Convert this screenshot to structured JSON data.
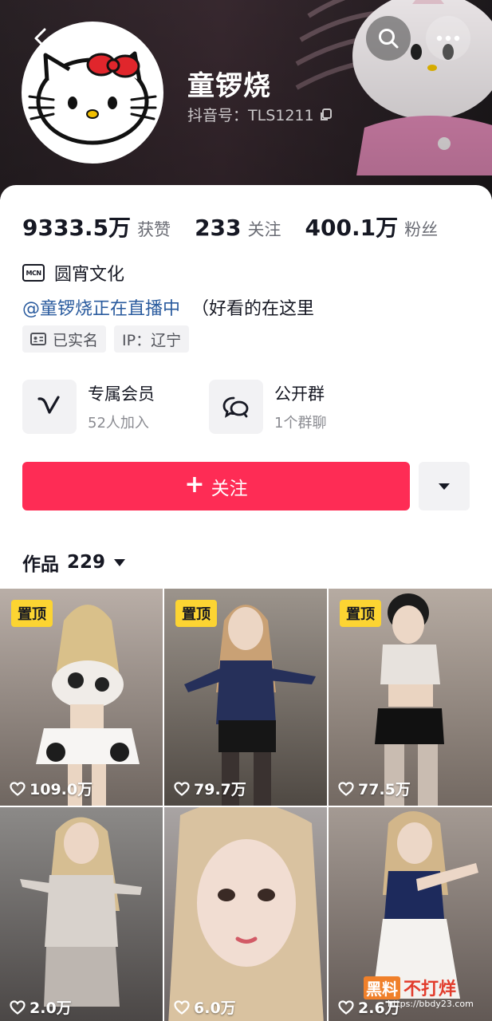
{
  "header": {
    "nickname": "童锣烧",
    "douyin_id": "抖音号：TLS1211"
  },
  "stats": [
    {
      "value": "9333.5万",
      "label": "获赞"
    },
    {
      "value": "233",
      "label": "关注"
    },
    {
      "value": "400.1万",
      "label": "粉丝"
    }
  ],
  "mcn": {
    "badge": "MCN",
    "name": "圆宵文化"
  },
  "bio": {
    "link": "@童锣烧正在直播中",
    "text": "（好看的在这里"
  },
  "tags": [
    {
      "label": "已实名",
      "icon": "id-card-icon"
    },
    {
      "label": "IP：辽宁"
    }
  ],
  "features": [
    {
      "title": "专属会员",
      "sub": "52人加入",
      "icon": "v-membership-icon"
    },
    {
      "title": "公开群",
      "sub": "1个群聊",
      "icon": "chat-bubbles-icon"
    }
  ],
  "follow_button": {
    "plus": "+",
    "label": "关注"
  },
  "works": {
    "label": "作品",
    "count": "229"
  },
  "videos": [
    {
      "pinned": "置顶",
      "likes": "109.0万"
    },
    {
      "pinned": "置顶",
      "likes": "79.7万"
    },
    {
      "pinned": "置顶",
      "likes": "77.5万"
    },
    {
      "pinned": "",
      "likes": "2.0万"
    },
    {
      "pinned": "",
      "likes": "6.0万"
    },
    {
      "pinned": "",
      "likes": "2.6万"
    }
  ],
  "watermark": {
    "brand_a": "黑料",
    "brand_b": "不打烊",
    "url": "https://bbdy23.com"
  },
  "colors": {
    "accent": "#fe2c55",
    "pin": "#fcd432",
    "link": "#2a5b9e"
  }
}
